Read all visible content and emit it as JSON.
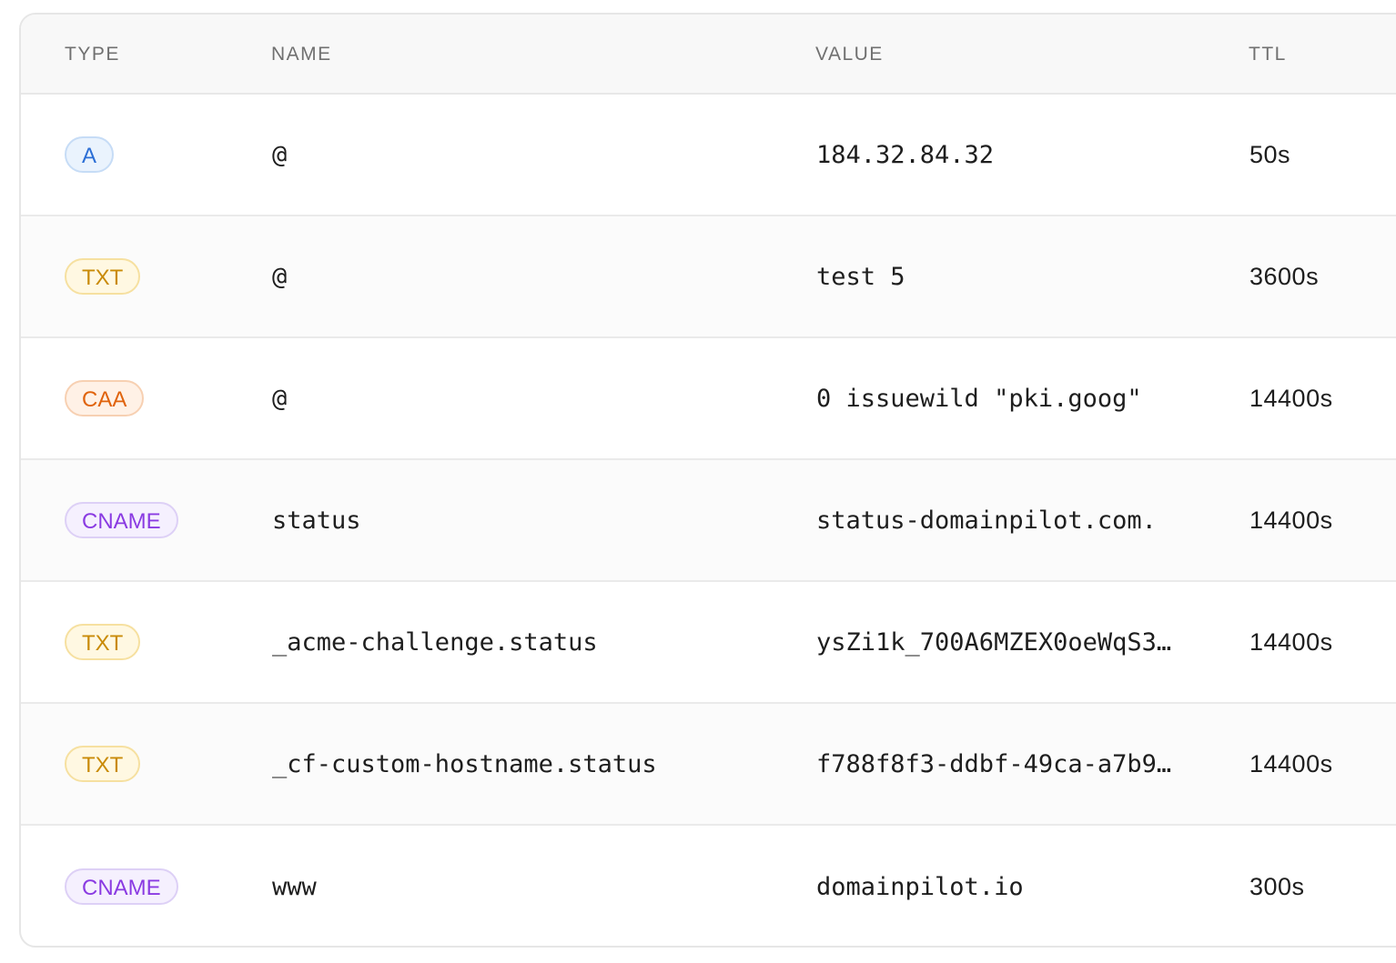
{
  "table": {
    "headers": {
      "type": "TYPE",
      "name": "NAME",
      "value": "VALUE",
      "ttl": "TTL"
    },
    "records": [
      {
        "type": "A",
        "name": "@",
        "value": "184.32.84.32",
        "ttl": "50s"
      },
      {
        "type": "TXT",
        "name": "@",
        "value": "test 5",
        "ttl": "3600s"
      },
      {
        "type": "CAA",
        "name": "@",
        "value": "0 issuewild \"pki.goog\"",
        "ttl": "14400s"
      },
      {
        "type": "CNAME",
        "name": "status",
        "value": "status-domainpilot.com.",
        "ttl": "14400s"
      },
      {
        "type": "TXT",
        "name": "_acme-challenge.status",
        "value": "ysZi1k_700A6MZEX0oeWqS3…",
        "ttl": "14400s"
      },
      {
        "type": "TXT",
        "name": "_cf-custom-hostname.status",
        "value": "f788f8f3-ddbf-49ca-a7b9…",
        "ttl": "14400s"
      },
      {
        "type": "CNAME",
        "name": "www",
        "value": "domainpilot.io",
        "ttl": "300s"
      }
    ]
  },
  "colors": {
    "A": "#2c6fd6",
    "TXT": "#c98a06",
    "CAA": "#e0630c",
    "CNAME": "#8a3be2"
  }
}
